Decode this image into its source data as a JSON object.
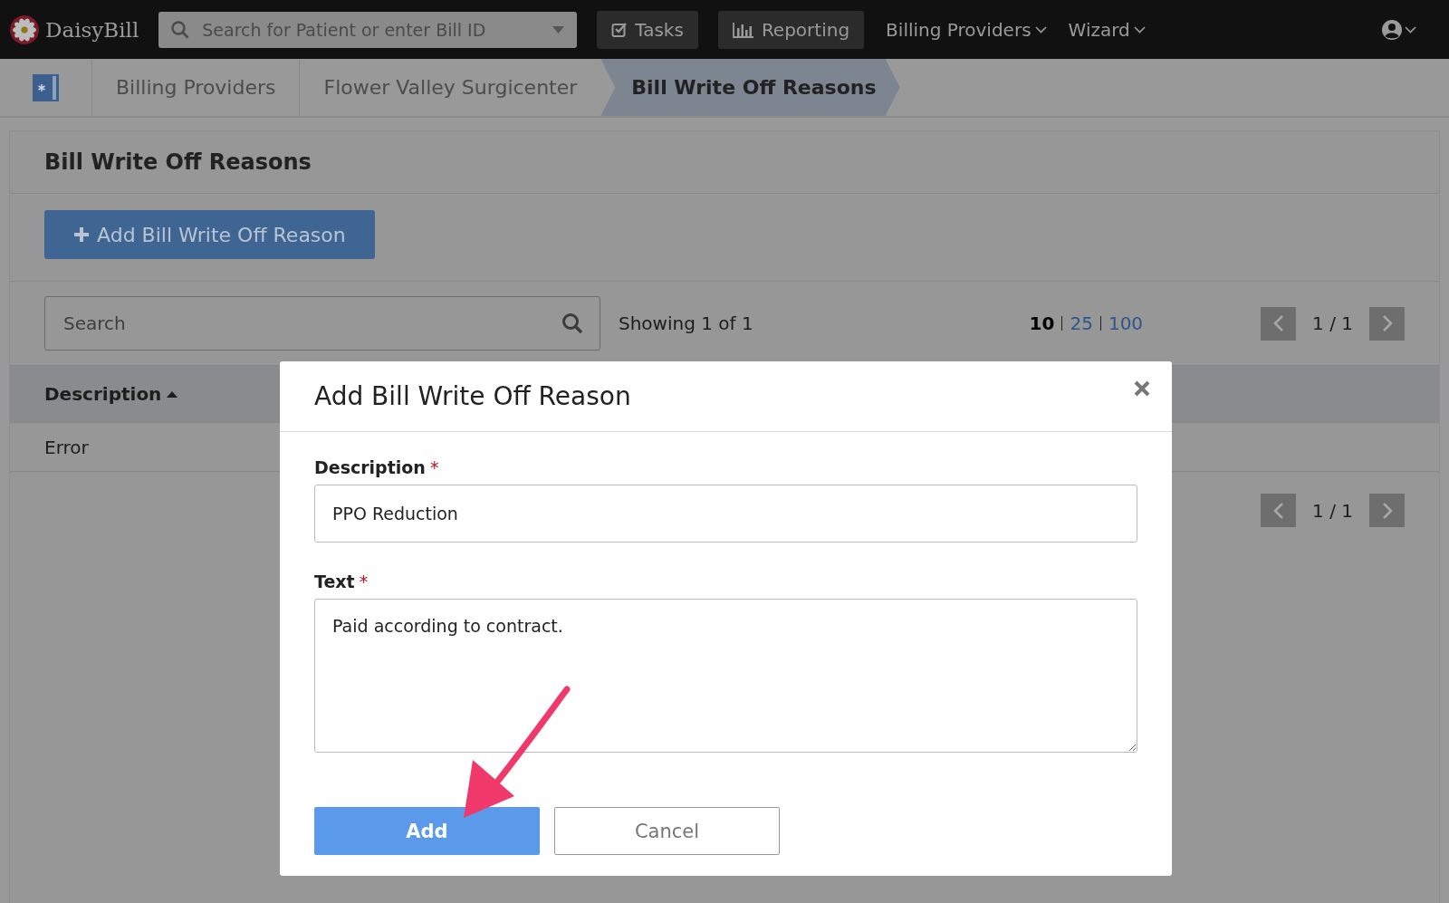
{
  "navbar": {
    "logo": "DaisyBill",
    "search": {
      "placeholder": "Search for Patient or enter Bill ID"
    },
    "buttons": [
      {
        "label": "Tasks",
        "kind": "tasks"
      },
      {
        "label": "Reporting",
        "kind": "reporting"
      }
    ],
    "menus": [
      "Billing Providers",
      "Wizard"
    ]
  },
  "breadcrumbs": [
    {
      "label": "Billing Providers",
      "selected": false
    },
    {
      "label": "Flower Valley Surgicenter",
      "selected": false
    },
    {
      "label": "Bill Write Off Reasons",
      "selected": true
    }
  ],
  "card": {
    "title": "Bill Write Off Reasons",
    "add_button": "Add Bill Write Off Reason",
    "search": {
      "placeholder": "Search"
    },
    "showing": "Showing 1 of 1",
    "page_sizes": [
      {
        "label": "10",
        "selected": true
      },
      {
        "label": "25",
        "selected": false
      },
      {
        "label": "100",
        "selected": false
      }
    ],
    "pager_top": "1 / 1",
    "pager_bottom": "1 / 1",
    "table": {
      "columns": [
        {
          "label": "Description",
          "sorted": true
        }
      ],
      "rows": [
        [
          "Error"
        ]
      ]
    }
  },
  "modal": {
    "title": "Add Bill Write Off Reason",
    "fields": [
      {
        "label": "Description",
        "required_mark": "*",
        "kind": "input",
        "value": "PPO Reduction"
      },
      {
        "label": "Text",
        "required_mark": "*",
        "kind": "textarea",
        "value": "Paid according to contract."
      }
    ],
    "buttons": [
      {
        "label": "Add",
        "kind": "primary"
      },
      {
        "label": "Cancel",
        "kind": "secondary"
      }
    ]
  }
}
